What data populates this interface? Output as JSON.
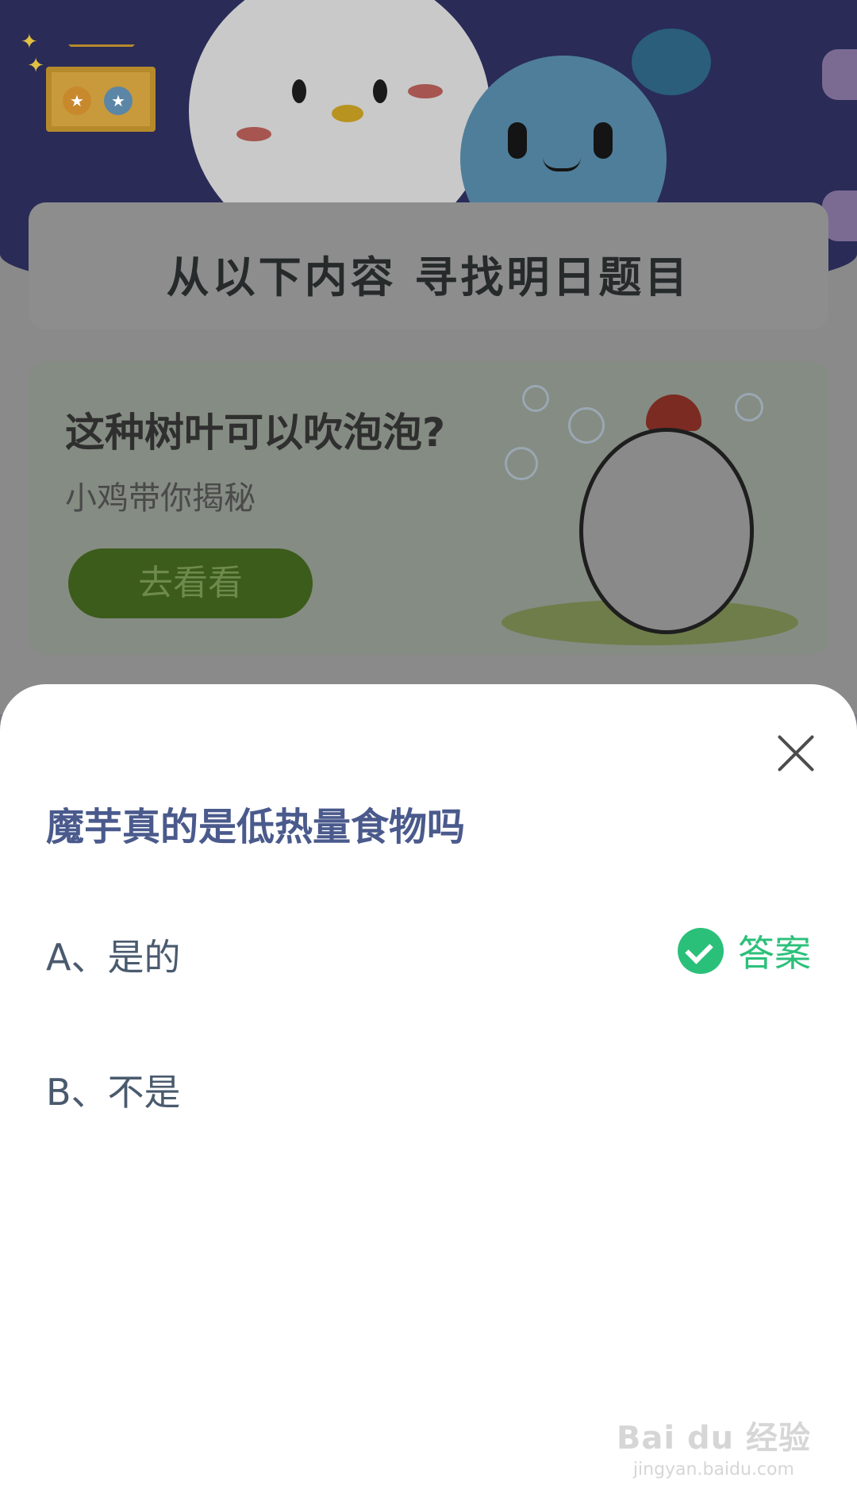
{
  "background": {
    "title_card": "从以下内容  寻找明日题目",
    "promo": {
      "title": "这种树叶可以吹泡泡?",
      "subtitle": "小鸡带你揭秘",
      "button_label": "去看看"
    }
  },
  "sheet": {
    "question": "魔芋真的是低热量食物吗",
    "options": [
      {
        "label": "A、是的",
        "is_answer": true
      },
      {
        "label": "B、不是",
        "is_answer": false
      }
    ],
    "answer_label": "答案"
  },
  "watermark": {
    "logo": "Bai du 经验",
    "url": "jingyan.baidu.com"
  },
  "colors": {
    "question": "#4a5a8c",
    "answer_green": "#2bc07a",
    "overlay_dim": "#7a7a82"
  }
}
